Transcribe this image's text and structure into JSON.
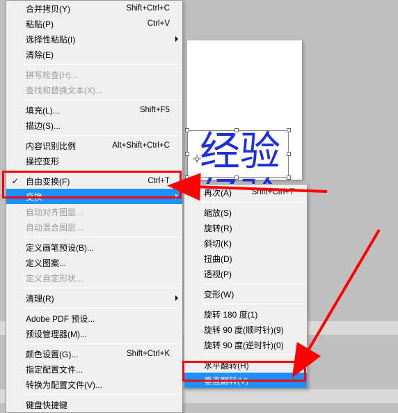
{
  "canvas": {
    "text1": "经验",
    "text2": "经验"
  },
  "main_menu": {
    "items": [
      {
        "label": "合并拷贝(Y)",
        "shortcut": "Shift+Ctrl+C",
        "enabled": true
      },
      {
        "label": "粘贴(P)",
        "shortcut": "Ctrl+V",
        "enabled": true
      },
      {
        "label": "选择性粘贴(I)",
        "submenu": true,
        "enabled": true
      },
      {
        "label": "清除(E)",
        "enabled": true
      },
      {
        "sep": true
      },
      {
        "label": "拼写检查(H)...",
        "enabled": false
      },
      {
        "label": "查找和替换文本(X)...",
        "enabled": false
      },
      {
        "sep": true
      },
      {
        "label": "填充(L)...",
        "shortcut": "Shift+F5",
        "enabled": true
      },
      {
        "label": "描边(S)...",
        "enabled": true
      },
      {
        "sep": true
      },
      {
        "label": "内容识别比例",
        "shortcut": "Alt+Shift+Ctrl+C",
        "enabled": true
      },
      {
        "label": "操控变形",
        "enabled": true
      },
      {
        "sep": true
      },
      {
        "label": "自由变换(F)",
        "shortcut": "Ctrl+T",
        "checked": true,
        "enabled": true
      },
      {
        "label": "变换",
        "submenu": true,
        "highlight": true,
        "enabled": true
      },
      {
        "label": "自动对齐图层...",
        "enabled": false
      },
      {
        "label": "自动混合图层...",
        "enabled": false
      },
      {
        "sep": true
      },
      {
        "label": "定义画笔预设(B)...",
        "enabled": true
      },
      {
        "label": "定义图案...",
        "enabled": true
      },
      {
        "label": "定义自定形状...",
        "enabled": false
      },
      {
        "sep": true
      },
      {
        "label": "清理(R)",
        "submenu": true,
        "enabled": true
      },
      {
        "sep": true
      },
      {
        "label": "Adobe PDF 预设...",
        "enabled": true
      },
      {
        "label": "预设管理器(M)...",
        "enabled": true
      },
      {
        "sep": true
      },
      {
        "label": "颜色设置(G)...",
        "shortcut": "Shift+Ctrl+K",
        "enabled": true
      },
      {
        "label": "指定配置文件...",
        "enabled": true
      },
      {
        "label": "转换为配置文件(V)...",
        "enabled": true
      },
      {
        "sep": true
      },
      {
        "label": "键盘快捷键",
        "enabled": true
      }
    ]
  },
  "sub_menu": {
    "items": [
      {
        "label": "再次(A)",
        "shortcut": "Shift+Ctrl+T",
        "enabled": true
      },
      {
        "sep": true
      },
      {
        "label": "缩放(S)",
        "enabled": true
      },
      {
        "label": "旋转(R)",
        "enabled": true
      },
      {
        "label": "斜切(K)",
        "enabled": true
      },
      {
        "label": "扭曲(D)",
        "enabled": true
      },
      {
        "label": "透视(P)",
        "enabled": true
      },
      {
        "sep": true
      },
      {
        "label": "变形(W)",
        "enabled": true
      },
      {
        "sep": true
      },
      {
        "label": "旋转 180 度(1)",
        "enabled": true
      },
      {
        "label": "旋转 90 度(顺时针)(9)",
        "enabled": true
      },
      {
        "label": "旋转 90 度(逆时针)(0)",
        "enabled": true
      },
      {
        "sep": true
      },
      {
        "label": "水平翻转(H)",
        "enabled": true
      },
      {
        "label": "垂直翻转(V)",
        "highlight": true,
        "enabled": true
      }
    ]
  }
}
